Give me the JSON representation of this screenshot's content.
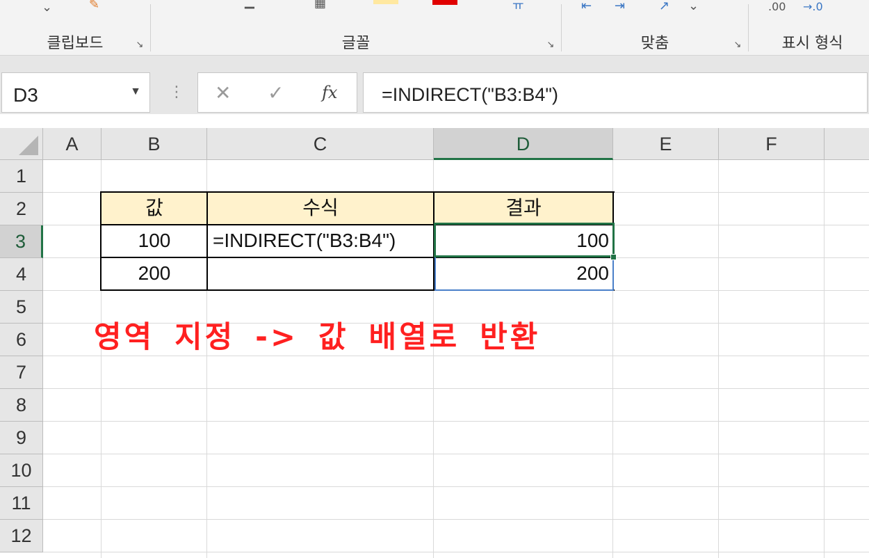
{
  "ribbon": {
    "groups": [
      {
        "label": "클립보드"
      },
      {
        "label": "글꼴"
      },
      {
        "label": "맞춤"
      },
      {
        "label": "표시 형식"
      }
    ],
    "number_format_icons": [
      ".00",
      "→.0"
    ]
  },
  "formula_bar": {
    "name_box": "D3",
    "cancel_symbol": "✕",
    "enter_symbol": "✓",
    "fx_label": "fx",
    "formula": "=INDIRECT(\"B3:B4\")"
  },
  "sheet": {
    "columns": [
      "A",
      "B",
      "C",
      "D",
      "E",
      "F"
    ],
    "selected_column": "D",
    "rows": [
      "1",
      "2",
      "3",
      "4",
      "5",
      "6",
      "7",
      "8",
      "9",
      "10",
      "11",
      "12"
    ],
    "selected_row": "3",
    "table": {
      "headers": [
        "값",
        "수식",
        "결과"
      ],
      "rows": [
        {
          "value": "100",
          "formula": "=INDIRECT(\"B3:B4\")",
          "result": "100"
        },
        {
          "value": "200",
          "formula": "",
          "result": "200"
        }
      ]
    },
    "annotation": "영역 지정 -> 값 배열로 반환",
    "colors": {
      "header_fill": "#fff2cc",
      "selection": "#217346",
      "annotation": "#ff2020"
    }
  }
}
